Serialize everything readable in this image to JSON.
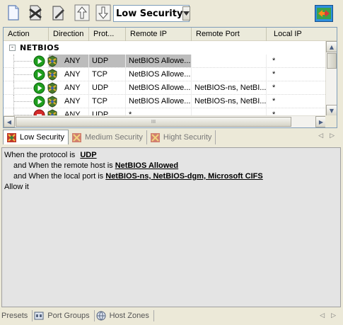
{
  "toolbar": {
    "buttons": [
      {
        "name": "new-rule-icon"
      },
      {
        "name": "delete-rule-icon"
      },
      {
        "name": "edit-rule-icon"
      },
      {
        "name": "move-up-icon"
      },
      {
        "name": "move-down-icon"
      }
    ],
    "profile_select": {
      "value": "Low Security"
    },
    "topright_icon": "transfer-arrows-icon"
  },
  "grid": {
    "columns": [
      "Action",
      "Direction",
      "Prot...",
      "Remote IP",
      "Remote Port",
      "Local IP"
    ],
    "group": {
      "expander": "-",
      "label": "NETBIOS"
    },
    "rows": [
      {
        "status": "allow",
        "direction": "ANY",
        "protocol": "UDP",
        "remote_ip": "NetBIOS Allowe...",
        "remote_port": "",
        "local_ip": "*",
        "selected": true
      },
      {
        "status": "allow",
        "direction": "ANY",
        "protocol": "TCP",
        "remote_ip": "NetBIOS Allowe...",
        "remote_port": "",
        "local_ip": "*",
        "selected": false
      },
      {
        "status": "allow",
        "direction": "ANY",
        "protocol": "UDP",
        "remote_ip": "NetBIOS Allowe...",
        "remote_port": "NetBIOS-ns, NetBI...",
        "local_ip": "*",
        "selected": false
      },
      {
        "status": "allow",
        "direction": "ANY",
        "protocol": "TCP",
        "remote_ip": "NetBIOS Allowe...",
        "remote_port": "NetBIOS-ns, NetBI...",
        "local_ip": "*",
        "selected": false
      },
      {
        "status": "block",
        "direction": "ANY",
        "protocol": "UDP",
        "remote_ip": "*",
        "remote_port": "",
        "local_ip": "*",
        "selected": false
      }
    ],
    "hscroll_grip": "III"
  },
  "profile_tabs": [
    {
      "label": "Low Security",
      "active": true
    },
    {
      "label": "Medium Security",
      "active": false
    },
    {
      "label": "Hight Security",
      "active": false
    }
  ],
  "description": {
    "line1_prefix": "When the protocol is",
    "line1_value": "UDP",
    "line2_prefix": "and When the remote host is",
    "line2_value": "NetBIOS Allowed",
    "line3_prefix": "and When the local port is",
    "line3_value": "NetBIOS-ns, NetBIOS-dgm, Microsoft CIFS",
    "line4": "Allow it"
  },
  "bottom_tabs": [
    {
      "label": "Presets"
    },
    {
      "label": "Port Groups"
    },
    {
      "label": "Host Zones"
    }
  ],
  "colors": {
    "background": "#ece9d8",
    "selected_row": "#bcbcbc",
    "allow": "#1e9e1e",
    "block": "#d42a2a"
  }
}
